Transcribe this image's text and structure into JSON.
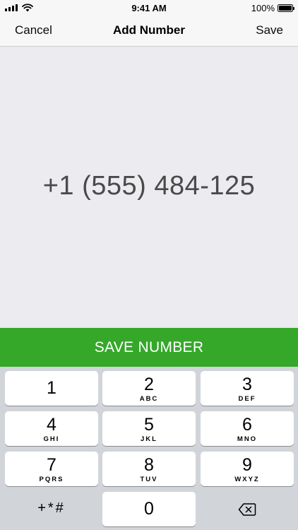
{
  "status_bar": {
    "time": "9:41 AM",
    "battery_percent_label": "100%",
    "battery_level": 1.0,
    "icons": [
      "signal-icon",
      "wifi-icon",
      "battery-icon"
    ]
  },
  "nav": {
    "left_label": "Cancel",
    "title": "Add Number",
    "right_label": "Save"
  },
  "display": {
    "number": "+1 (555) 484-125"
  },
  "save_button": {
    "label": "SAVE NUMBER"
  },
  "colors": {
    "accent_green": "#35a82a",
    "display_background": "#ebebf0",
    "keypad_background": "#d1d4d9"
  },
  "keypad": {
    "keys": [
      {
        "digit": "1",
        "letters": ""
      },
      {
        "digit": "2",
        "letters": "ABC"
      },
      {
        "digit": "3",
        "letters": "DEF"
      },
      {
        "digit": "4",
        "letters": "GHI"
      },
      {
        "digit": "5",
        "letters": "JKL"
      },
      {
        "digit": "6",
        "letters": "MNO"
      },
      {
        "digit": "7",
        "letters": "PQRS"
      },
      {
        "digit": "8",
        "letters": "TUV"
      },
      {
        "digit": "9",
        "letters": "WXYZ"
      }
    ],
    "symbols_label": "+*#",
    "zero_digit": "0",
    "delete_icon": "backspace-icon"
  }
}
